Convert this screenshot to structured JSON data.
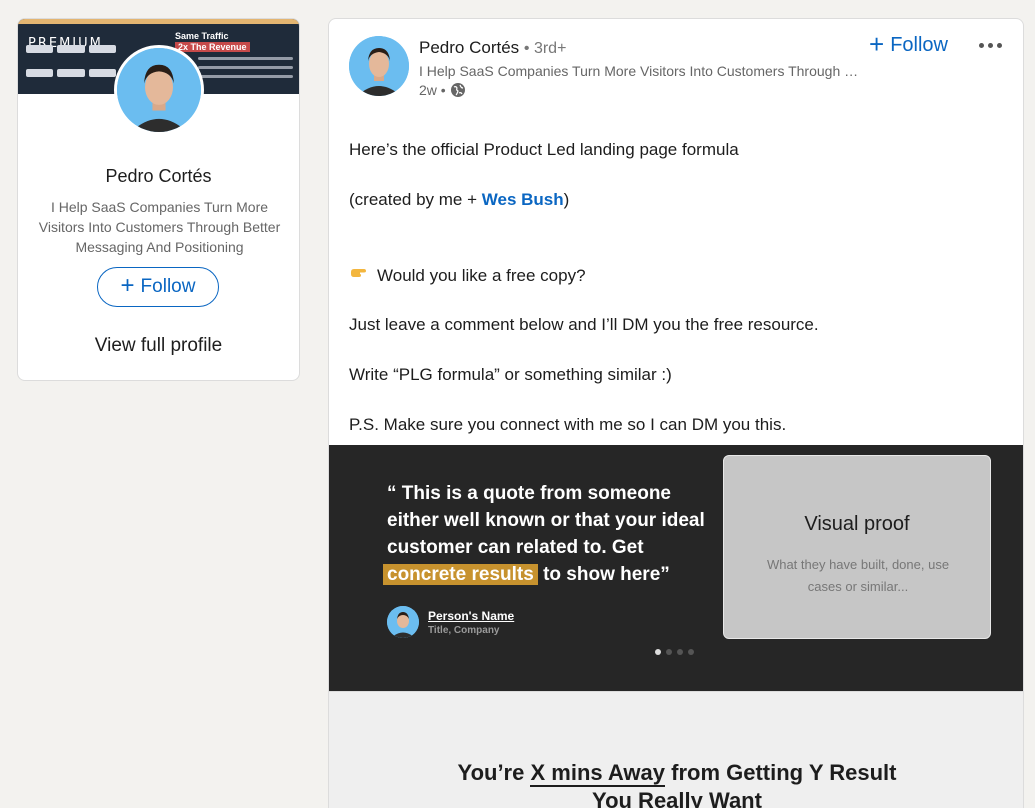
{
  "profile_card": {
    "banner": {
      "premium_label": "PREMIUM",
      "headline": "Same Traffic",
      "revenue": "2x The Revenue"
    },
    "name": "Pedro Cortés",
    "headline": "I Help SaaS Companies Turn More Visitors Into Customers Through Better Messaging And Positioning",
    "follow_label": "Follow",
    "view_profile_label": "View full profile"
  },
  "post": {
    "author": {
      "name": "Pedro Cortés",
      "degree": "• 3rd+",
      "headline": "I Help SaaS Companies Turn More Visitors Into Customers Through Better Messaging And Positioning",
      "time": "2w •"
    },
    "follow_label": "Follow",
    "body": {
      "line1": "Here’s the official Product Led landing page formula",
      "line2_prefix": "(created by me + ",
      "line2_link": "Wes Bush",
      "line2_suffix": ")",
      "line3": "Would you like a free copy?",
      "line4": "Just leave a comment below and I’ll DM you the free resource.",
      "line5": "Write “PLG formula” or something similar :)",
      "line6": "P.S. Make sure you connect with me so I can DM you this."
    },
    "image": {
      "quote_part1": "“ This is a quote from someone either well known or that your ideal customer can related to. Get ",
      "quote_highlight": "concrete results",
      "quote_part2": " to show here”",
      "person_name": "Person's Name",
      "person_title": "Title, Company",
      "visual_proof_title": "Visual proof",
      "visual_proof_sub": "What they have built, done, use cases or similar..."
    },
    "image2": {
      "headline_prefix": "You’re ",
      "headline_underlined": "X mins Away",
      "headline_suffix": " from Getting Y Result",
      "headline_line2": "You Really Want"
    }
  },
  "colors": {
    "link_blue": "#0a66c2",
    "highlight_gold": "#c7922e",
    "dark_bg": "#262626"
  }
}
